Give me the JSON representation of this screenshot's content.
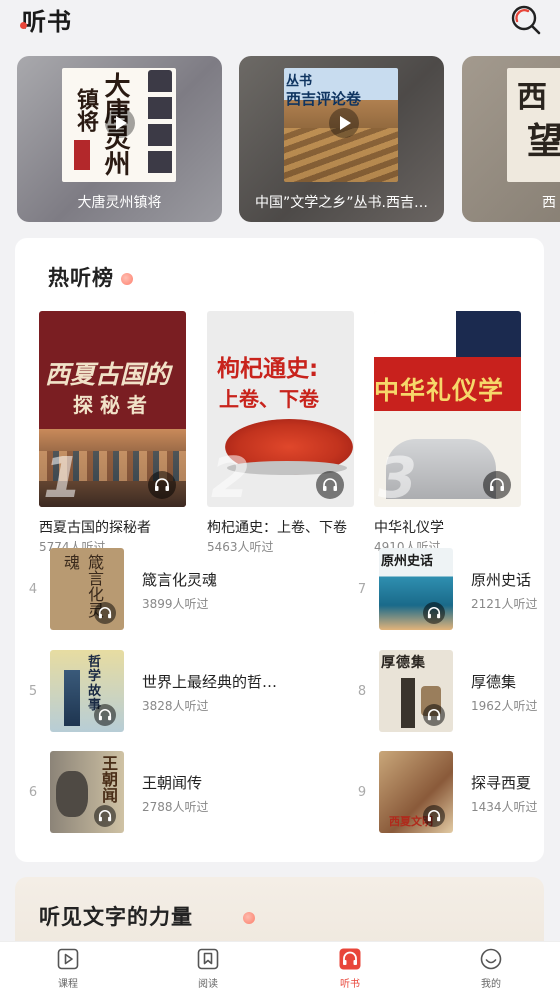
{
  "header": {
    "title": "听书",
    "search_icon": "search-icon"
  },
  "banners": [
    {
      "caption": "大唐灵州镇将",
      "cover_text": "大唐灵州",
      "cover_text2": "镇将"
    },
    {
      "caption": "中国”文学之乡”丛书.西吉…",
      "cover_text": "丛书",
      "cover_text2": "西吉评论卷"
    },
    {
      "caption": "西",
      "cover_text": "西",
      "cover_text2": "望"
    }
  ],
  "hot": {
    "title": "热听榜",
    "top": [
      {
        "rank": "1",
        "title": "西夏古国的探秘者",
        "count": "5774人听过",
        "cover_line1": "西夏古国的",
        "cover_line2": "探 秘 者"
      },
      {
        "rank": "2",
        "title": "枸杞通史：上卷、下卷",
        "count": "5463人听过",
        "cover_line1": "枸杞通史:",
        "cover_line2": "上卷、下卷"
      },
      {
        "rank": "3",
        "title": "中华礼仪学",
        "count": "4910人听过",
        "cover_line1": "中华礼仪学",
        "cover_line2": ""
      }
    ],
    "list": [
      {
        "rank": "4",
        "title": "箴言化灵魂",
        "count": "3899人听过",
        "cover_text": "箴言化灵魂"
      },
      {
        "rank": "5",
        "title": "世界上最经典的哲…",
        "count": "3828人听过",
        "cover_text": "哲学故事"
      },
      {
        "rank": "6",
        "title": "王朝闻传",
        "count": "2788人听过",
        "cover_text": "王朝闻"
      },
      {
        "rank": "7",
        "title": "原州史话",
        "count": "2121人听过",
        "cover_text": "原州史话"
      },
      {
        "rank": "8",
        "title": "厚德集",
        "count": "1962人听过",
        "cover_text": "厚德集"
      },
      {
        "rank": "9",
        "title": "探寻西夏",
        "count": "1434人听过",
        "cover_text": "西夏文明"
      }
    ]
  },
  "power": {
    "title": "听见文字的力量"
  },
  "nav": [
    {
      "label": "课程",
      "icon": "play-icon",
      "active": false
    },
    {
      "label": "阅读",
      "icon": "bookmark-icon",
      "active": false
    },
    {
      "label": "听书",
      "icon": "headphone-icon",
      "active": true
    },
    {
      "label": "我的",
      "icon": "smile-icon",
      "active": false
    }
  ],
  "colors": {
    "accent": "#e8463a",
    "background": "#f2f2f4"
  }
}
